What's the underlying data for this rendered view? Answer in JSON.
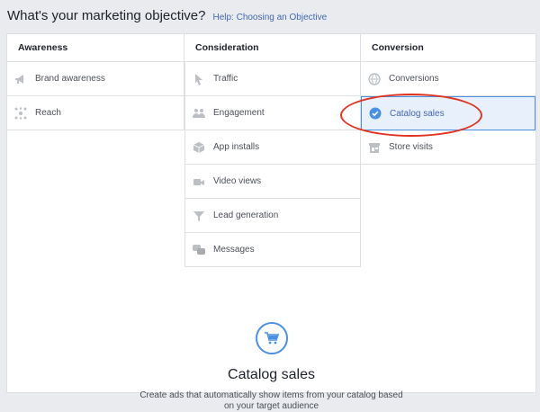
{
  "header": {
    "title": "What's your marketing objective?",
    "help_link": "Help: Choosing an Objective"
  },
  "columns": [
    {
      "heading": "Awareness",
      "items": [
        {
          "label": "Brand awareness",
          "icon": "megaphone-icon"
        },
        {
          "label": "Reach",
          "icon": "reach-icon"
        }
      ]
    },
    {
      "heading": "Consideration",
      "items": [
        {
          "label": "Traffic",
          "icon": "cursor-icon"
        },
        {
          "label": "Engagement",
          "icon": "people-icon"
        },
        {
          "label": "App installs",
          "icon": "box-icon"
        },
        {
          "label": "Video views",
          "icon": "video-camera-icon"
        },
        {
          "label": "Lead generation",
          "icon": "funnel-icon"
        },
        {
          "label": "Messages",
          "icon": "chat-bubbles-icon"
        }
      ]
    },
    {
      "heading": "Conversion",
      "items": [
        {
          "label": "Conversions",
          "icon": "globe-icon"
        },
        {
          "label": "Catalog sales",
          "icon": "check-circle-icon",
          "selected": true
        },
        {
          "label": "Store visits",
          "icon": "store-icon"
        }
      ]
    }
  ],
  "selected_objective": {
    "title": "Catalog sales",
    "description": "Create ads that automatically show items from your catalog based on your target audience",
    "icon": "cart-icon"
  },
  "colors": {
    "accent": "#4a90e2",
    "link": "#4267b2",
    "annotation_ring": "#e0321e",
    "selected_bg": "#e7f0fb"
  }
}
